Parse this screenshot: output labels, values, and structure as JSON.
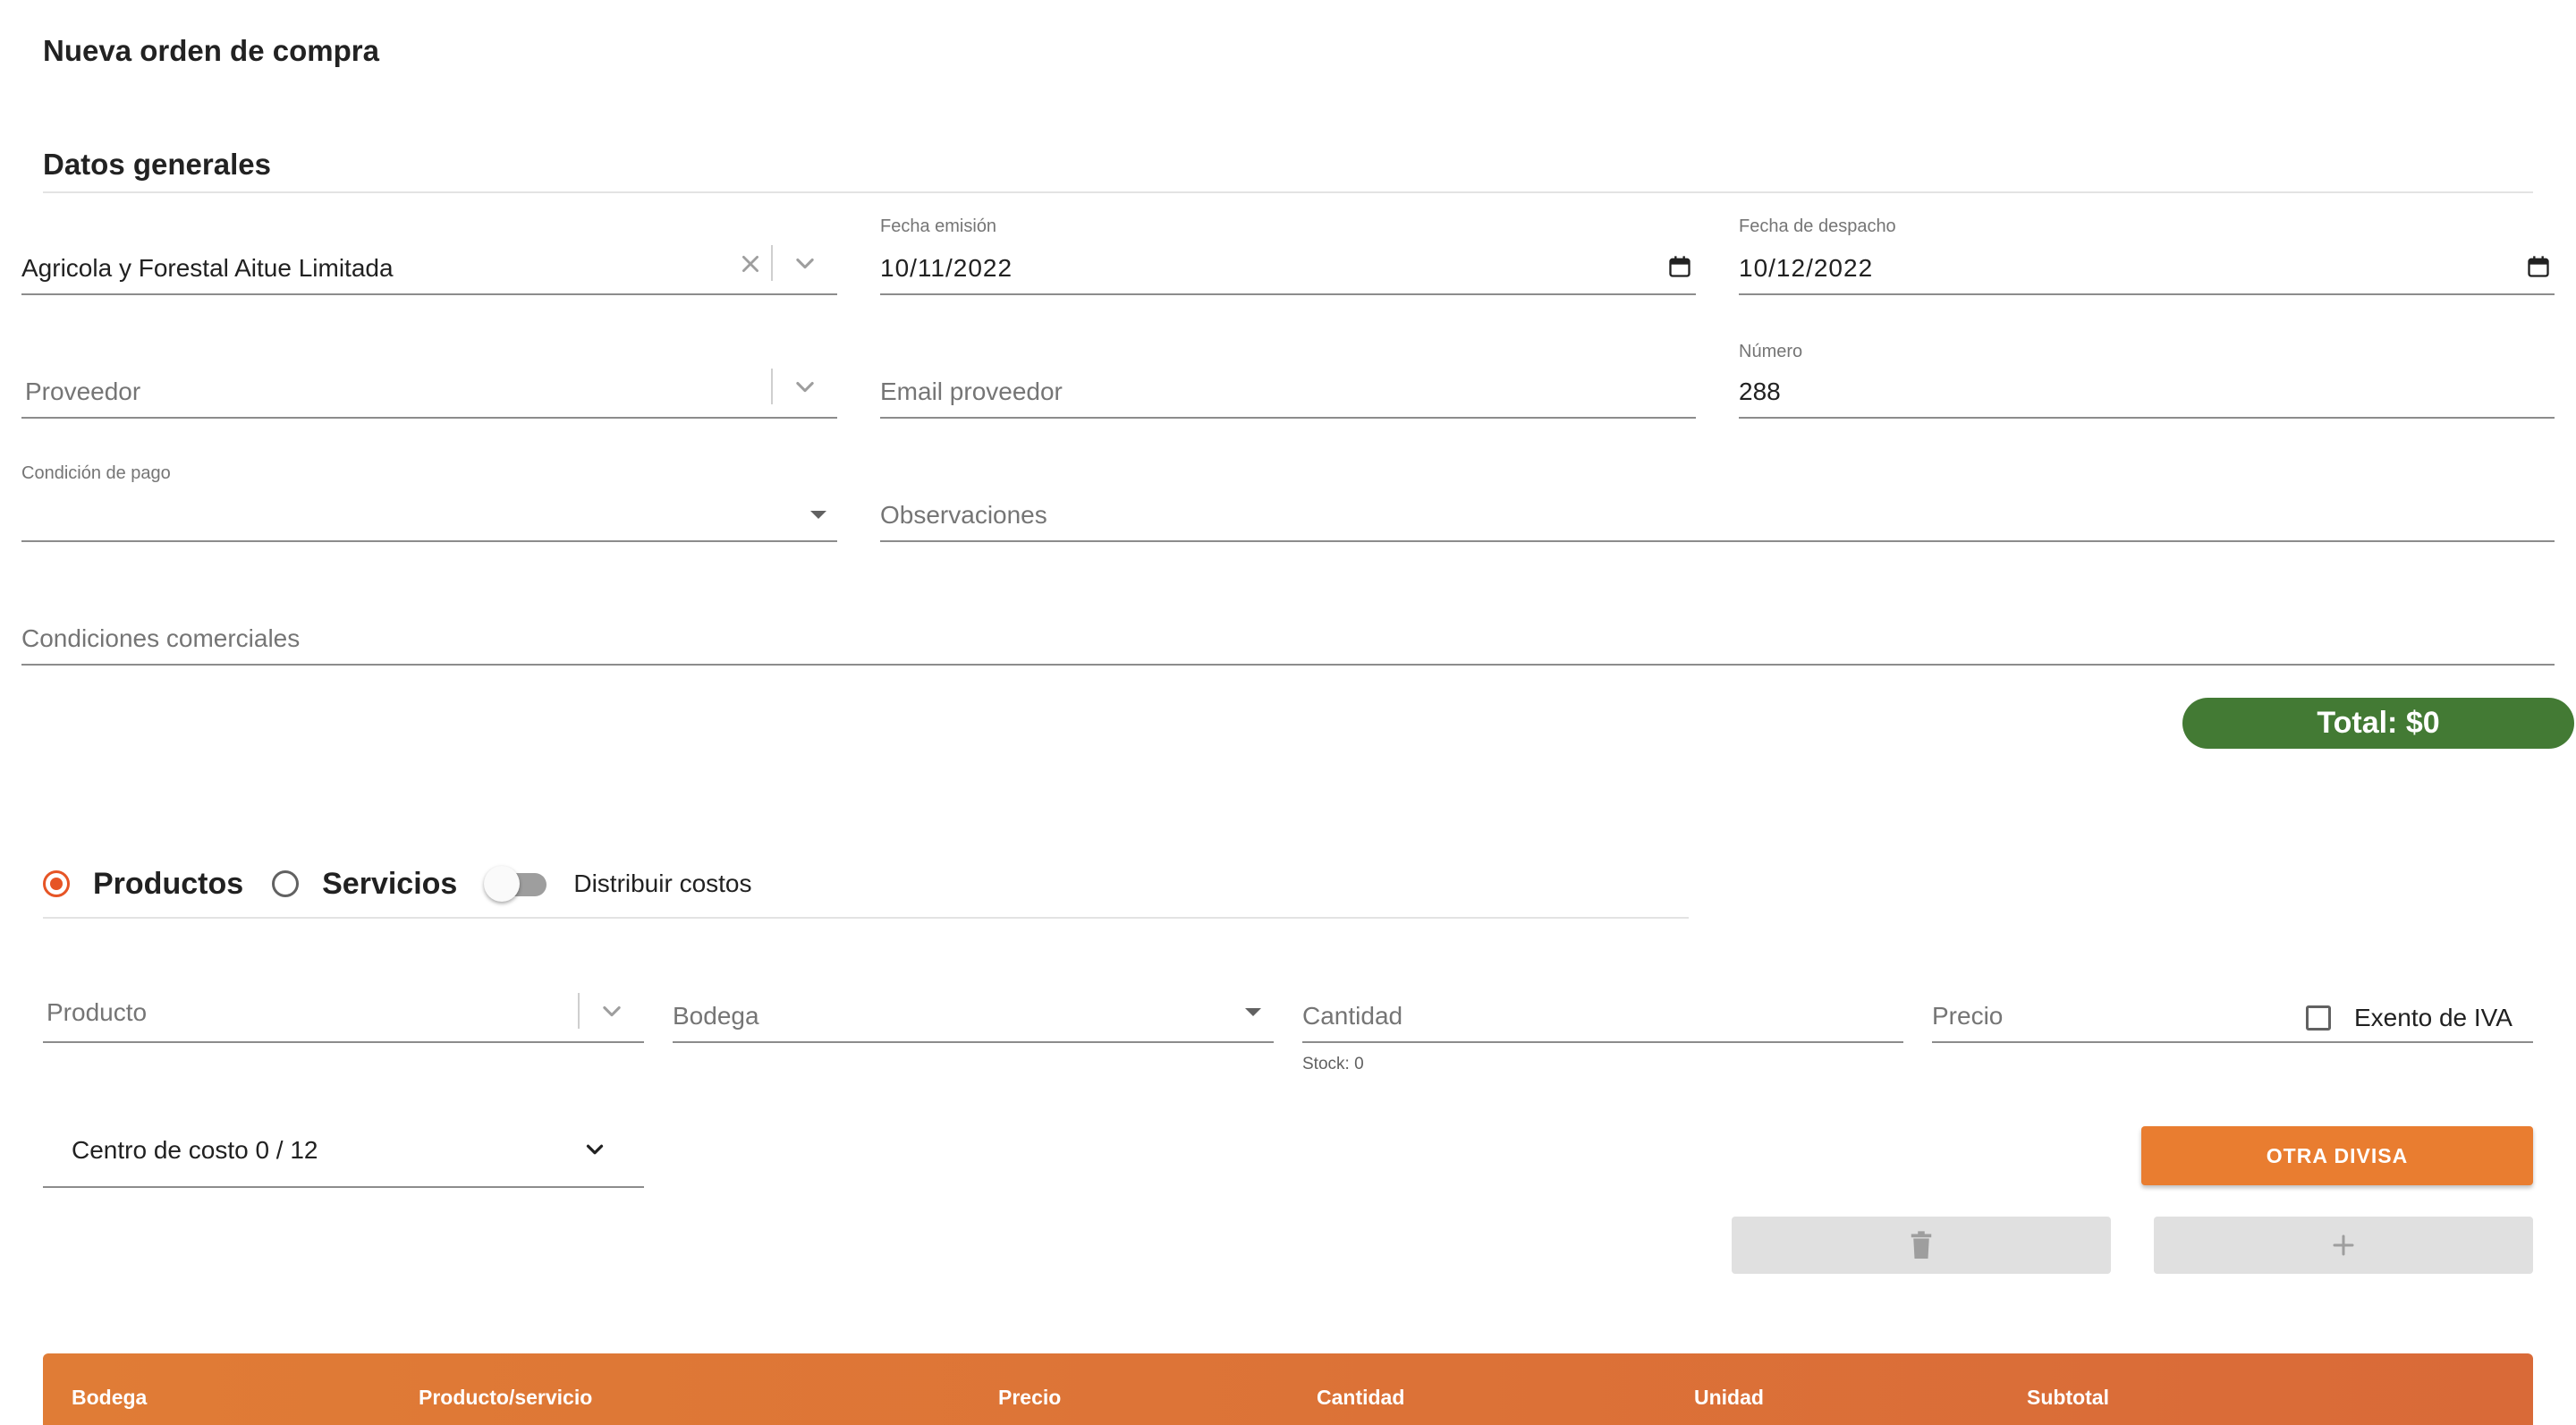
{
  "page": {
    "title": "Nueva orden de compra"
  },
  "section": {
    "title": "Datos generales"
  },
  "form": {
    "empresa": {
      "value": "Agricola y Forestal Aitue Limitada",
      "clear_icon": "close-icon",
      "chevron_icon": "chevron-down-icon"
    },
    "fecha_emision": {
      "label": "Fecha emisión",
      "value": "10/11/2022",
      "icon": "calendar-icon"
    },
    "fecha_despacho": {
      "label": "Fecha de despacho",
      "value": "10/12/2022",
      "icon": "calendar-icon"
    },
    "proveedor": {
      "placeholder": "Proveedor",
      "chevron_icon": "chevron-down-icon"
    },
    "email_proveedor": {
      "placeholder": "Email proveedor"
    },
    "numero": {
      "label": "Número",
      "value": "288"
    },
    "condicion_pago": {
      "label": "Condición de pago",
      "value": "",
      "caret_icon": "caret-down-icon"
    },
    "observaciones": {
      "placeholder": "Observaciones"
    },
    "condiciones_comerciales": {
      "placeholder": "Condiciones comerciales"
    }
  },
  "total": {
    "label": "Total: $0",
    "color": "#437a34"
  },
  "items": {
    "type_options": [
      {
        "label": "Productos",
        "selected": true
      },
      {
        "label": "Servicios",
        "selected": false
      }
    ],
    "distribuir_costos": {
      "label": "Distribuir costos",
      "on": false
    },
    "producto": {
      "placeholder": "Producto",
      "chevron_icon": "chevron-down-icon"
    },
    "bodega": {
      "placeholder": "Bodega",
      "caret_icon": "caret-down-icon"
    },
    "cantidad": {
      "placeholder": "Cantidad",
      "helper": "Stock: 0"
    },
    "precio": {
      "placeholder": "Precio"
    },
    "exento_iva": {
      "label": "Exento de IVA",
      "checked": false
    },
    "centro_costo": {
      "label": "Centro de costo 0 / 12",
      "chevron_icon": "chevron-down-icon"
    },
    "otra_divisa_button": {
      "label": "OTRA DIVISA",
      "color": "#e97d30"
    },
    "delete_button": {
      "icon": "trash-icon"
    },
    "add_button": {
      "icon": "plus-icon"
    }
  },
  "table": {
    "accent": "#e07c36",
    "columns": [
      "Bodega",
      "Producto/servicio",
      "Precio",
      "Cantidad",
      "Unidad",
      "Subtotal"
    ]
  }
}
